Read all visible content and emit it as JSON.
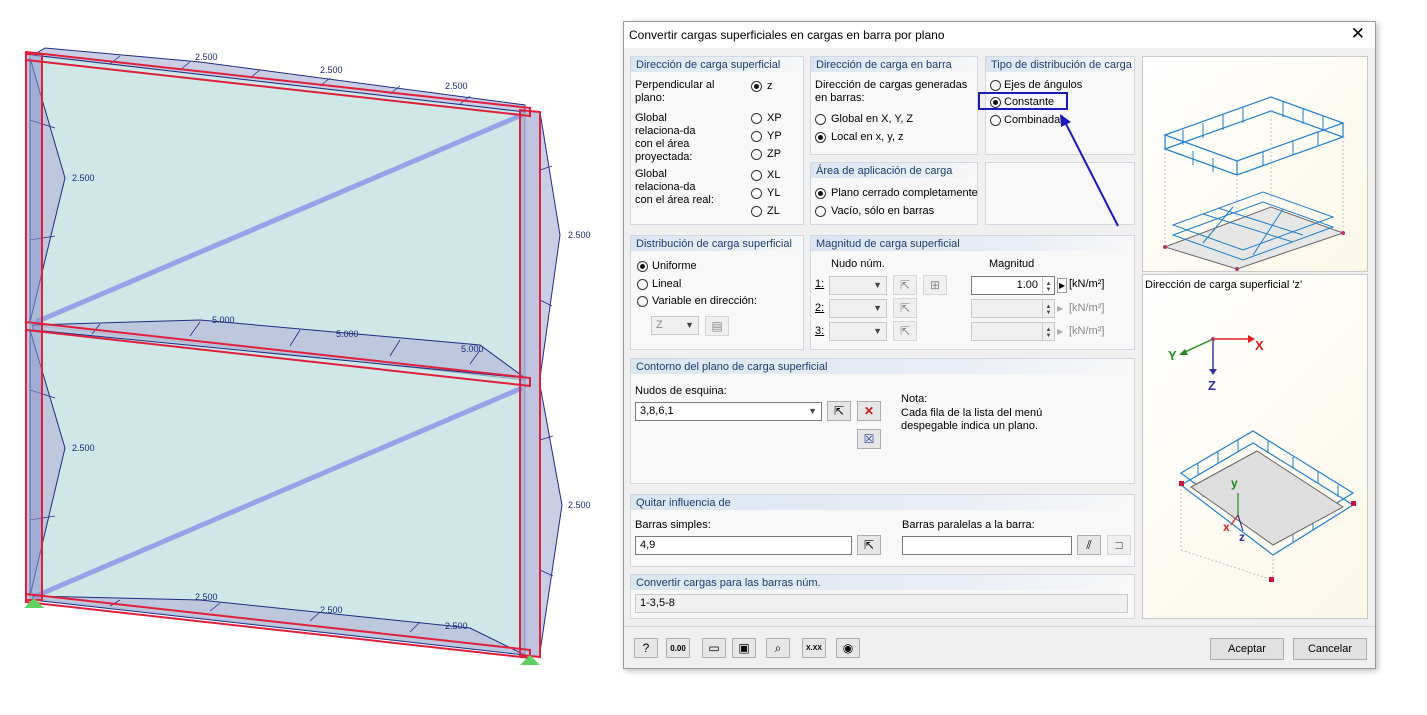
{
  "model": {
    "labels": [
      "2.500",
      "2.500",
      "2.500",
      "2.500",
      "2.500",
      "5.000",
      "5.000",
      "5.000",
      "2.500",
      "2.500",
      "2.500",
      "2.500",
      "2.500"
    ]
  },
  "dialog": {
    "title": "Convertir cargas superficiales en cargas en barra por plano",
    "close_glyph": "✕",
    "surface_dir": {
      "title": "Dirección de carga superficial",
      "perp_label": "Perpendicular al plano:",
      "z": "z",
      "proj_label": "Global relaciona-da con el área proyectada:",
      "xp": "XP",
      "yp": "YP",
      "zp": "ZP",
      "real_label": "Global relaciona-da con el área real:",
      "xl": "XL",
      "yl": "YL",
      "zl": "ZL"
    },
    "member_dir": {
      "title": "Dirección de carga en barra",
      "desc": "Dirección de cargas generadas en barras:",
      "global": "Global en X, Y, Z",
      "local": "Local en x, y, z"
    },
    "dist_type": {
      "title": "Tipo de distribución de carga",
      "angles": "Ejes de ángulos",
      "constant": "Constante",
      "combined": "Combinada"
    },
    "apply_area": {
      "title": "Área de aplicación de carga",
      "closed": "Plano cerrado completamente",
      "empty": "Vacío, sólo en barras"
    },
    "surface_dist": {
      "title": "Distribución de carga superficial",
      "uniform": "Uniforme",
      "linear": "Lineal",
      "variable": "Variable en dirección:",
      "direction_value": "Z"
    },
    "magnitude": {
      "title": "Magnitud de carga superficial",
      "node_header": "Nudo núm.",
      "mag_header": "Magnitud",
      "rows": [
        {
          "label": "1:",
          "value": "1.00",
          "unit": "[kN/m²]"
        },
        {
          "label": "2:",
          "value": "",
          "unit": "[kN/m²]"
        },
        {
          "label": "3:",
          "value": "",
          "unit": "[kN/m²]"
        }
      ]
    },
    "contour": {
      "title": "Contorno del plano de carga superficial",
      "corner_label": "Nudos de esquina:",
      "corner_value": "3,8,6,1",
      "note_title": "Nota:",
      "note_text": "Cada fila de la lista del menú despegable indica un plano."
    },
    "remove": {
      "title": "Quitar influencia de",
      "simple_label": "Barras simples:",
      "simple_value": "4,9",
      "parallel_label": "Barras paralelas a la barra:",
      "parallel_value": ""
    },
    "convert": {
      "title": "Convertir cargas para las barras núm.",
      "value": "1-3,5-8"
    },
    "preview_caption": "Dirección de carga superficial 'z'",
    "axes": {
      "x": "X",
      "y": "Y",
      "z": "Z",
      "lx": "x",
      "ly": "y",
      "lz": "z"
    },
    "footer": {
      "ok": "Aceptar",
      "cancel": "Cancelar",
      "num_icon_text": "0.00",
      "xxx_icon_text": "X.XX"
    }
  }
}
